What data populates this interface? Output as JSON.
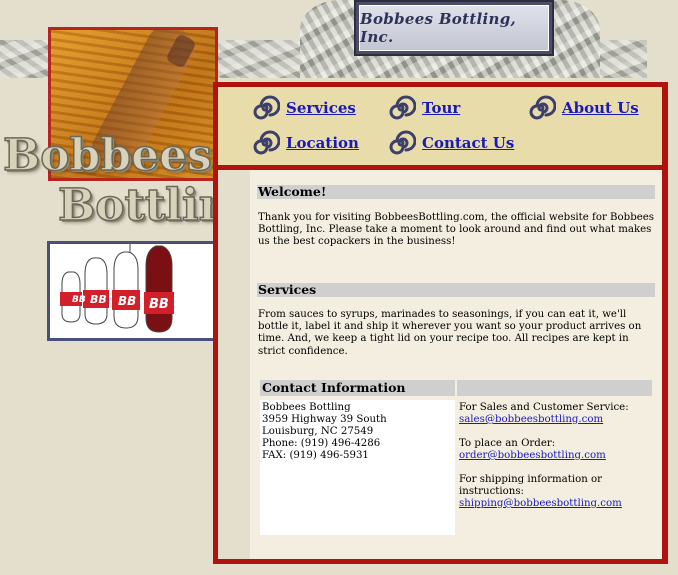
{
  "header": {
    "plaque_title": "Bobbees Bottling, Inc.",
    "logo_line1": "Bobbees",
    "logo_line2": "Bottling"
  },
  "nav": {
    "items": [
      {
        "label": "Services",
        "icon": "spiral-icon"
      },
      {
        "label": "Tour",
        "icon": "spiral-icon"
      },
      {
        "label": "About Us",
        "icon": "spiral-icon"
      },
      {
        "label": "Location",
        "icon": "spiral-icon"
      },
      {
        "label": "Contact Us",
        "icon": "spiral-icon"
      }
    ]
  },
  "welcome": {
    "heading": "Welcome!",
    "text": "Thank you for visiting BobbeesBottling.com, the official website for Bobbees Bottling, Inc. Please take a moment to look around and find out what makes us the best copackers in the business!"
  },
  "services": {
    "heading": "Services",
    "text": "From sauces to syrups, marinades to seasonings, if you can eat it, we'll bottle it, label it and ship it wherever you want so your product arrives on time. And, we keep a tight lid on your recipe too. All recipes are kept in strict confidence."
  },
  "contact": {
    "heading": "Contact Information",
    "address_lines": [
      "Bobbees Bottling",
      "3959 Highway 39 South",
      "Louisburg, NC 27549",
      "Phone: (919) 496-4286",
      "FAX: (919) 496-5931"
    ],
    "sales_label": "For Sales and Customer Service:",
    "sales_email": "sales@bobbeesbottling.com",
    "order_label": "To place an Order:",
    "order_email": "order@bobbeesbottling.com",
    "shipping_label": "For shipping information or instructions:",
    "shipping_email": "shipping@bobbeesbottling.com"
  },
  "illustration": {
    "bottle_label": "BB"
  },
  "colors": {
    "frame_red": "#b0120e",
    "nav_bg": "#e8dcab",
    "link_blue": "#1a1ab8",
    "plaque_navy": "#4b4e66"
  }
}
